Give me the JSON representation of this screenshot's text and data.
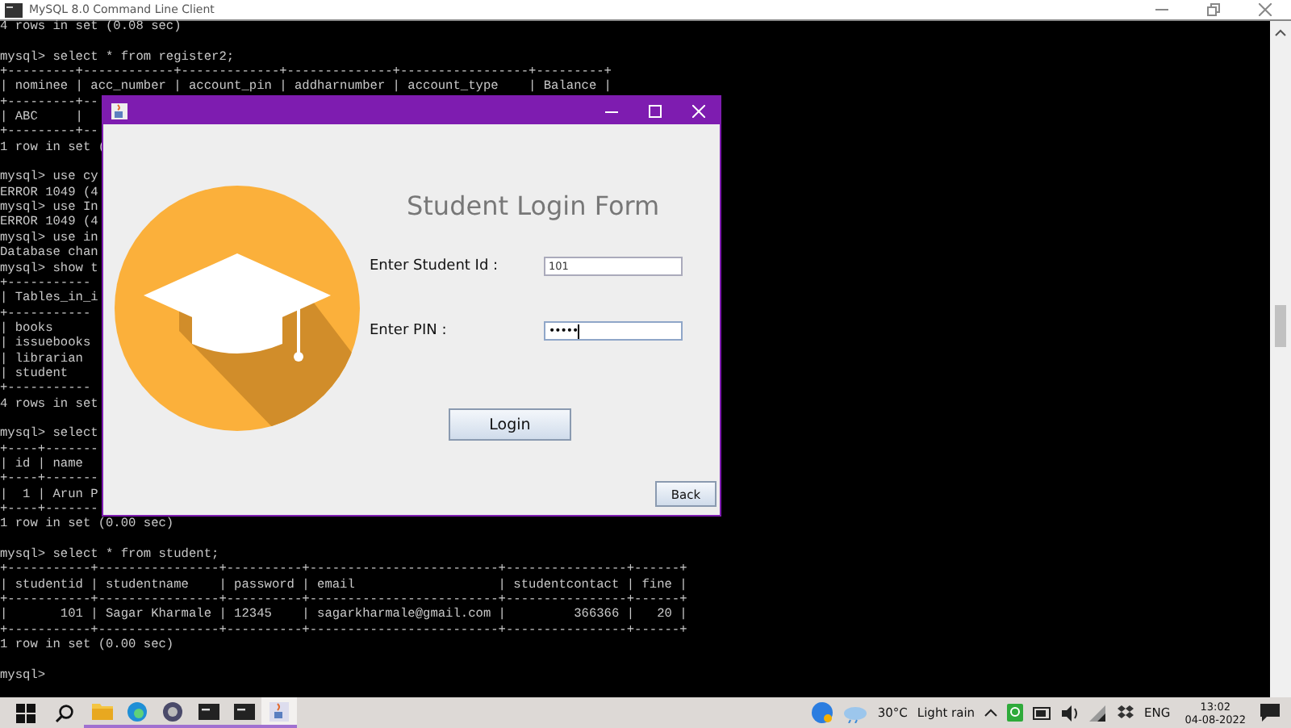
{
  "console_window": {
    "title": "MySQL 8.0 Command Line Client",
    "blocks": [
      [
        "4 rows in set (0.08 sec)"
      ],
      [
        "mysql> select * from register2;",
        "+---------+------------+-------------+--------------+-----------------+---------+",
        "| nominee | acc_number | account_pin | addharnumber | account_type    | Balance |",
        "+---------+--",
        "| ABC     |",
        "+---------+--",
        "1 row in set ("
      ],
      [
        "mysql> use cy",
        "ERROR 1049 (4",
        "mysql> use In",
        "ERROR 1049 (4",
        "mysql> use in",
        "Database chan",
        "mysql> show t",
        "+-----------",
        "| Tables_in_i",
        "+-----------",
        "| books",
        "| issuebooks",
        "| librarian",
        "| student",
        "+-----------",
        "4 rows in set"
      ],
      [
        "mysql> select",
        "+----+-------",
        "| id | name",
        "+----+-------",
        "|  1 | Arun P",
        "+----+-------",
        "1 row in set (0.00 sec)"
      ],
      [
        "mysql> select * from student;",
        "+-----------+----------------+----------+-------------------------+----------------+------+",
        "| studentid | studentname    | password | email                   | studentcontact | fine |",
        "+-----------+----------------+----------+-------------------------+----------------+------+",
        "|       101 | Sagar Kharmale | 12345    | sagarkharmale@gmail.com |         366366 |   20 |",
        "+-----------+----------------+----------+-------------------------+----------------+------+",
        "1 row in set (0.00 sec)"
      ],
      [
        "mysql>"
      ]
    ]
  },
  "dialog": {
    "heading": "Student Login Form",
    "fields": [
      {
        "label": "Enter Student Id :",
        "value": "101",
        "kind": "text",
        "focused": false
      },
      {
        "label": "Enter PIN :",
        "value": "•••••",
        "kind": "password",
        "focused": true
      }
    ],
    "login_button": "Login",
    "back_button": "Back"
  },
  "taskbar": {
    "apps": [
      {
        "kind": "folder",
        "selected": false
      },
      {
        "kind": "browser",
        "selected": false
      },
      {
        "kind": "camera",
        "selected": false
      },
      {
        "kind": "console",
        "selected": false
      },
      {
        "kind": "console",
        "selected": false
      },
      {
        "kind": "java",
        "selected": true
      }
    ],
    "temperature": "30°C",
    "weather": "Light rain",
    "language": "ENG",
    "time": "13:02",
    "date": "04-08-2022"
  }
}
